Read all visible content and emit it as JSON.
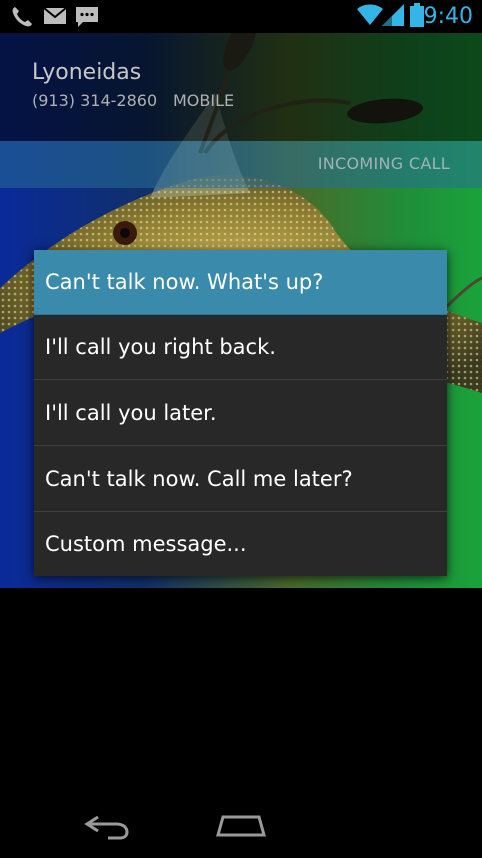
{
  "status_bar": {
    "time": "9:40",
    "icons": [
      "phone-icon",
      "gmail-icon",
      "sms-icon",
      "wifi-icon",
      "signal-icon",
      "battery-icon"
    ],
    "accent_color": "#33b5e5"
  },
  "caller": {
    "name": "Lyoneidas",
    "number": "(913) 314-2860",
    "type": "MOBILE"
  },
  "call_status": {
    "label": "INCOMING CALL"
  },
  "quick_responses": {
    "items": [
      {
        "label": "Can't talk now. What's up?",
        "selected": true
      },
      {
        "label": "I'll call you right back.",
        "selected": false
      },
      {
        "label": "I'll call you later.",
        "selected": false
      },
      {
        "label": "Can't talk now. Call me later?",
        "selected": false
      },
      {
        "label": "Custom message...",
        "selected": false
      }
    ],
    "highlight_color": "#3a8bab"
  },
  "nav_bar": {
    "buttons": [
      "back-icon",
      "home-icon"
    ]
  }
}
